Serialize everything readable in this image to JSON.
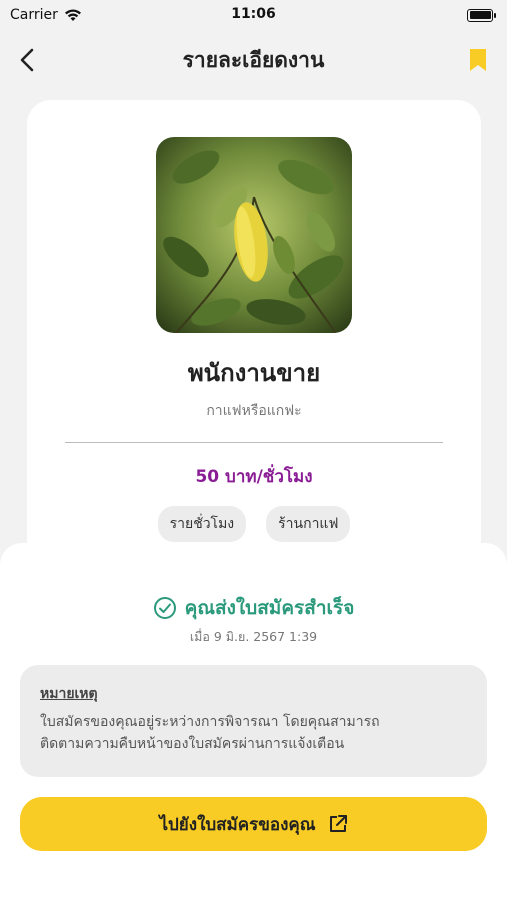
{
  "status_bar": {
    "carrier": "Carrier",
    "time": "11:06"
  },
  "nav": {
    "title": "รายละเอียดงาน"
  },
  "job": {
    "title": "พนักงานขาย",
    "company": "กาแฟหรือแกฟะ",
    "pay": "50 บาท/ชั่วโมง",
    "tags": [
      "รายชั่วโมง",
      "ร้านกาแฟ"
    ]
  },
  "application": {
    "success_text": "คุณส่งใบสมัครสำเร็จ",
    "sent_time": "เมื่อ 9 มิ.ย. 2567 1:39",
    "note_title": "หมายเหตุ",
    "note_line1": "ใบสมัครของคุณอยู่ระหว่างการพิจารณา โดยคุณสามารถ",
    "note_line2": "ติดตามความคืบหน้าของใบสมัครผ่านการแจ้งเตือน",
    "cta_label": "ไปยังใบสมัครของคุณ"
  },
  "colors": {
    "accent_yellow": "#f8cc24",
    "pay_purple": "#8a1d95",
    "success_green": "#2b9a7c"
  },
  "icons": {
    "back": "chevron-left-icon",
    "bookmark": "bookmark-icon",
    "success": "check-circle-icon",
    "cta": "external-link-icon"
  }
}
